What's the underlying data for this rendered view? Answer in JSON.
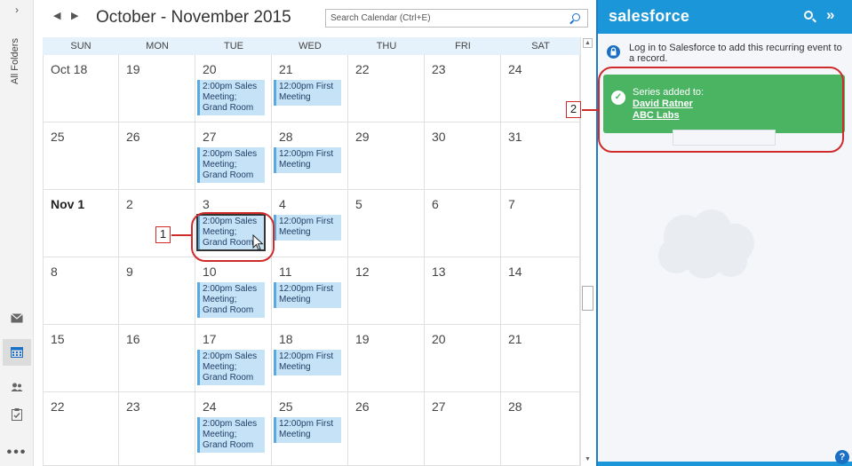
{
  "nav": {
    "expand_glyph": "›",
    "all_folders_label": "All Folders",
    "icons": [
      "mail-icon",
      "calendar-icon",
      "people-icon",
      "tasks-icon",
      "more-icon"
    ],
    "more_glyph": "•••"
  },
  "calendar": {
    "prev_glyph": "◀",
    "next_glyph": "▶",
    "title": "October - November 2015",
    "search_placeholder": "Search Calendar (Ctrl+E)",
    "day_headers": [
      "SUN",
      "MON",
      "TUE",
      "WED",
      "THU",
      "FRI",
      "SAT"
    ],
    "weeks": [
      [
        "Oct 18",
        "19",
        "20",
        "21",
        "22",
        "23",
        "24"
      ],
      [
        "25",
        "26",
        "27",
        "28",
        "29",
        "30",
        "31"
      ],
      [
        "Nov 1",
        "2",
        "3",
        "4",
        "5",
        "6",
        "7"
      ],
      [
        "8",
        "9",
        "10",
        "11",
        "12",
        "13",
        "14"
      ],
      [
        "15",
        "16",
        "17",
        "18",
        "19",
        "20",
        "21"
      ],
      [
        "22",
        "23",
        "24",
        "25",
        "26",
        "27",
        "28"
      ]
    ],
    "tue_event": "2:00pm Sales Meeting; Grand Room",
    "wed_event": "12:00pm First Meeting",
    "scroll_up_glyph": "▲",
    "scroll_down_glyph": "▼"
  },
  "salesforce": {
    "logo": "salesforce",
    "expand_glyph": "»",
    "login_message": "Log in to Salesforce to add this recurring event to a record.",
    "success_heading": "Series added to:",
    "success_links": [
      "David Ratner",
      "ABC Labs"
    ],
    "help_glyph": "?",
    "lock_glyph": "🔒",
    "check_glyph": "✓"
  },
  "callouts": [
    "1",
    "2"
  ],
  "colors": {
    "accent_blue": "#1b96d8",
    "event_fill": "#c6e2f7",
    "success_green": "#4bb463",
    "callout_red": "#d02b2b"
  }
}
